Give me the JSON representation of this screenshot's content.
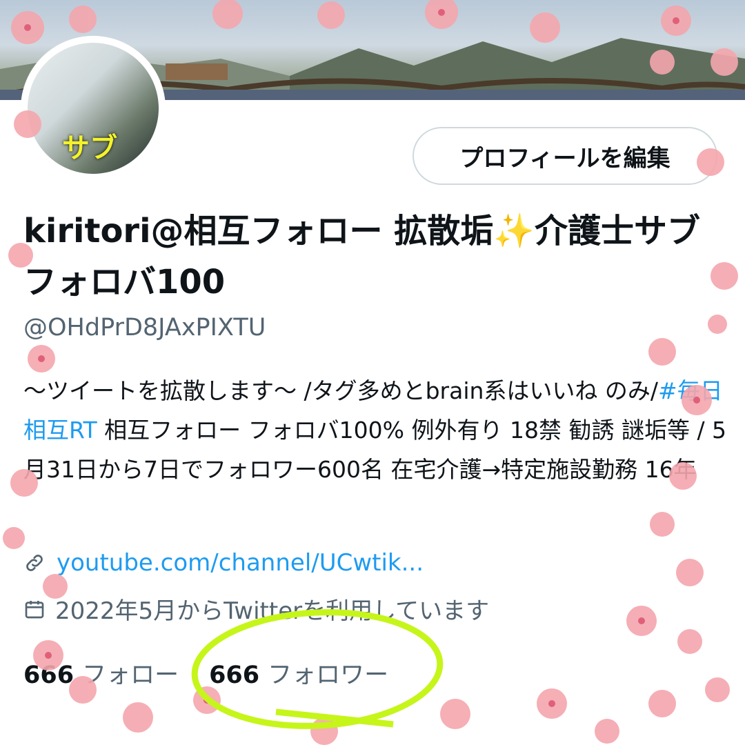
{
  "profile": {
    "avatar_text": "サブ",
    "edit_button": "プロフィールを編集",
    "display_name": "kiritori@相互フォロー 拡散垢✨介護士サブ フォロバ100",
    "handle": "@OHdPrD8JAxPIXTU",
    "bio_part1": "〜ツイートを拡散します〜 /タグ多めとbrain系はいいね のみ/",
    "bio_hashtag": "#毎日相互RT",
    "bio_part2": " 相互フォロー フォロバ100% 例外有り 18禁 勧誘 謎垢等 / 5月31日から7日でフォロワー600名  在宅介護→特定施設勤務 16年",
    "link": "youtube.com/channel/UCwtik...",
    "joined": "2022年5月からTwitterを利用しています",
    "following_count": "666",
    "following_label": "フォロー",
    "followers_count": "666",
    "followers_label": "フォロワー"
  },
  "icons": {
    "link": "link-icon",
    "calendar": "calendar-icon"
  },
  "colors": {
    "accent": "#1d9bf0",
    "highlight_circle": "#c6f51a",
    "blossom": "#f4a6ad"
  }
}
